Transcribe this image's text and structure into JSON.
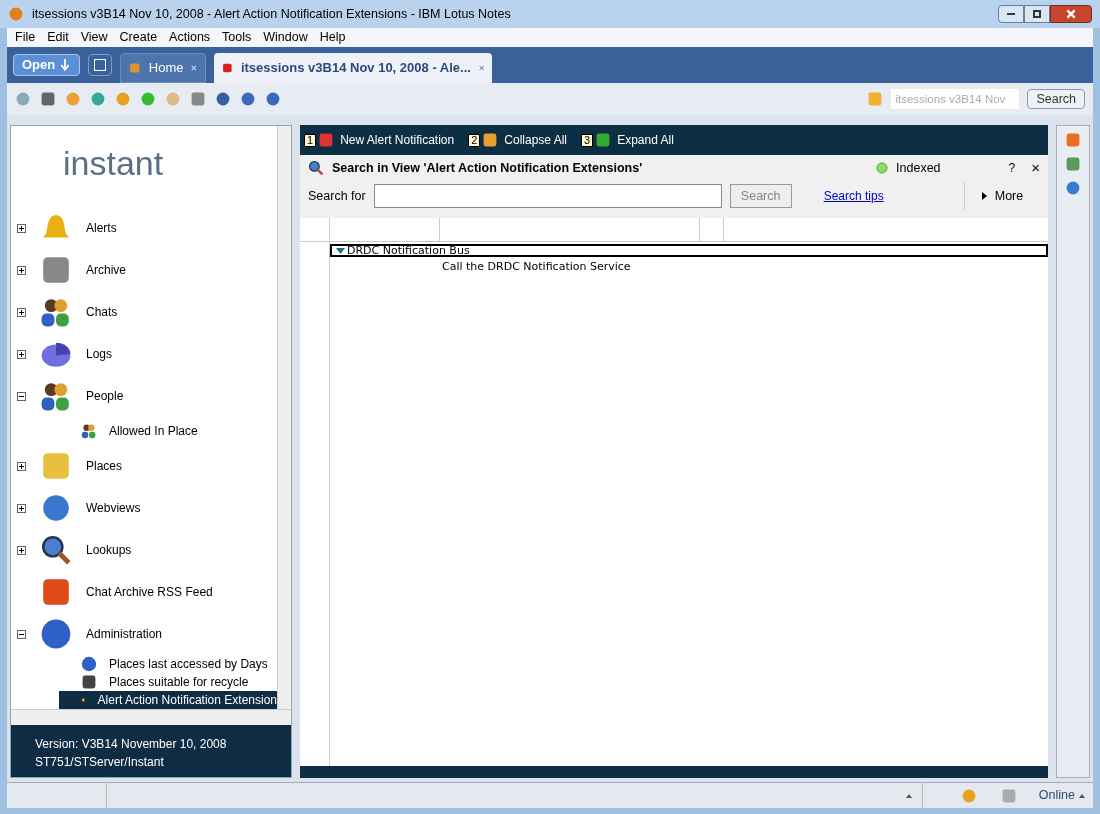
{
  "window": {
    "title": "itsessions v3B14 Nov 10, 2008 - Alert Action Notification Extensions - IBM Lotus Notes"
  },
  "menu": [
    "File",
    "Edit",
    "View",
    "Create",
    "Actions",
    "Tools",
    "Window",
    "Help"
  ],
  "open_button": "Open",
  "tabs": [
    {
      "label": "Home",
      "selected": false
    },
    {
      "label": "itsessions v3B14 Nov 10, 2008 - Ale...",
      "selected": true
    }
  ],
  "toolbar_search": {
    "placeholder": "itsessions v3B14 Nov",
    "button": "Search"
  },
  "sidebar": {
    "logo": "instant",
    "items": [
      {
        "label": "Alerts",
        "expanded": false
      },
      {
        "label": "Archive",
        "expanded": false
      },
      {
        "label": "Chats",
        "expanded": false
      },
      {
        "label": "Logs",
        "expanded": false
      },
      {
        "label": "People",
        "expanded": true,
        "children": [
          {
            "label": "Allowed In Place",
            "selected": false
          }
        ]
      },
      {
        "label": "Places",
        "expanded": false
      },
      {
        "label": "Webviews",
        "expanded": false
      },
      {
        "label": "Lookups",
        "expanded": false
      },
      {
        "label": "Chat Archive RSS Feed"
      },
      {
        "label": "Administration",
        "expanded": true,
        "children": [
          {
            "label": "Places last accessed by Days",
            "selected": false
          },
          {
            "label": "Places suitable for recycle",
            "selected": false
          },
          {
            "label": "Alert Action Notification Extension",
            "selected": true
          }
        ]
      }
    ],
    "footer": [
      "Version: V3B14 November 10, 2008",
      "ST751/STServer/Instant"
    ]
  },
  "actions": [
    {
      "number": "1",
      "label": "New Alert Notification"
    },
    {
      "number": "2",
      "label": "Collapse All"
    },
    {
      "number": "3",
      "label": "Expand All"
    }
  ],
  "search_panel": {
    "title": "Search in View 'Alert Action Notification Extensions'",
    "status": "Indexed",
    "help": "?",
    "close": "×",
    "label": "Search for",
    "button": "Search",
    "button_disabled": true,
    "link": "Search tips",
    "more": "More"
  },
  "view": {
    "rows": [
      {
        "label": "DRDC Notification Bus",
        "expanded": true,
        "children": [
          {
            "label": "Call the DRDC Notification Service"
          }
        ]
      }
    ]
  },
  "status_bar": {
    "status": "Online"
  }
}
